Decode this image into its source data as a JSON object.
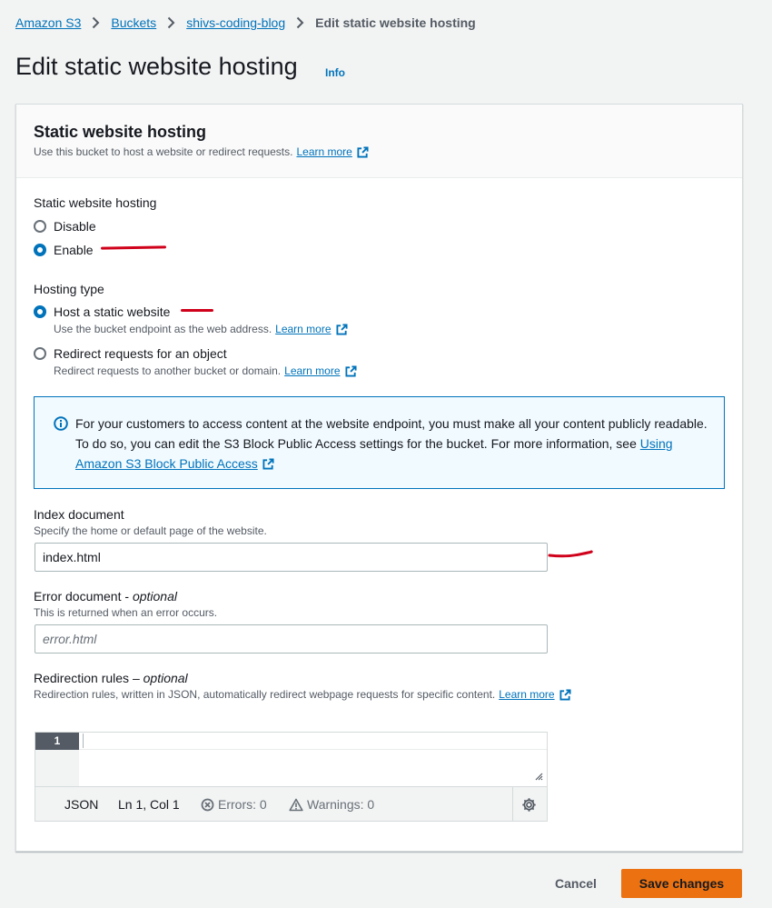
{
  "breadcrumb": {
    "items": [
      "Amazon S3",
      "Buckets",
      "shivs-coding-blog"
    ],
    "current": "Edit static website hosting"
  },
  "page": {
    "title": "Edit static website hosting",
    "info": "Info"
  },
  "panel": {
    "title": "Static website hosting",
    "description": "Use this bucket to host a website or redirect requests.",
    "learn_more": "Learn more"
  },
  "hosting": {
    "label": "Static website hosting",
    "options": [
      "Disable",
      "Enable"
    ],
    "selected": "Enable"
  },
  "hosting_type": {
    "label": "Hosting type",
    "options": [
      {
        "label": "Host a static website",
        "description": "Use the bucket endpoint as the web address.",
        "learn_more": "Learn more"
      },
      {
        "label": "Redirect requests for an object",
        "description": "Redirect requests to another bucket or domain.",
        "learn_more": "Learn more"
      }
    ],
    "selected": "Host a static website"
  },
  "alert": {
    "text": "For your customers to access content at the website endpoint, you must make all your content publicly readable. To do so, you can edit the S3 Block Public Access settings for the bucket. For more information, see",
    "link": "Using Amazon S3 Block Public Access"
  },
  "index_document": {
    "label": "Index document",
    "description": "Specify the home or default page of the website.",
    "value": "index.html"
  },
  "error_document": {
    "label": "Error document - ",
    "optional": "optional",
    "description": "This is returned when an error occurs.",
    "placeholder": "error.html"
  },
  "redirection_rules": {
    "label": "Redirection rules – ",
    "optional": "optional",
    "description": "Redirection rules, written in JSON, automatically redirect webpage requests for specific content.",
    "learn_more": "Learn more"
  },
  "editor": {
    "line_number": "1",
    "language": "JSON",
    "position": "Ln 1, Col 1",
    "errors": "Errors: 0",
    "warnings": "Warnings: 0"
  },
  "actions": {
    "cancel": "Cancel",
    "save": "Save changes"
  },
  "colors": {
    "link": "#0073bb",
    "primary_button": "#ec7211",
    "annotation_red": "#d0021b"
  }
}
